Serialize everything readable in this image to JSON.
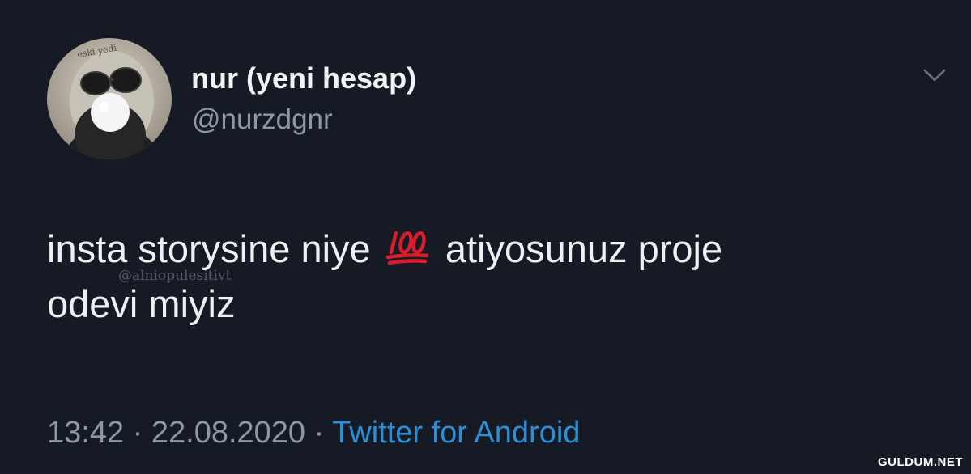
{
  "user": {
    "display_name": "nur (yeni hesap)",
    "handle": "@nurzdgnr",
    "avatar_icon": "profile-avatar",
    "avatar_caption": "eski yedi"
  },
  "tweet": {
    "line1_part1": "insta storysine  niye",
    "emoji": "100-emoji",
    "line1_part2": "atiyosunuz proje",
    "line2": "odevi miyiz"
  },
  "watermark_text": "@alniopulesitivt",
  "meta": {
    "time": "13:42",
    "separator": "·",
    "date": "22.08.2020",
    "source": "Twitter for Android"
  },
  "site_watermark": "GULDUM.NET",
  "colors": {
    "background": "#151a24",
    "text_primary": "#eef0f1",
    "text_secondary": "#8b98a5",
    "link": "#2b8fd8",
    "emoji_red": "#d81e2c"
  }
}
